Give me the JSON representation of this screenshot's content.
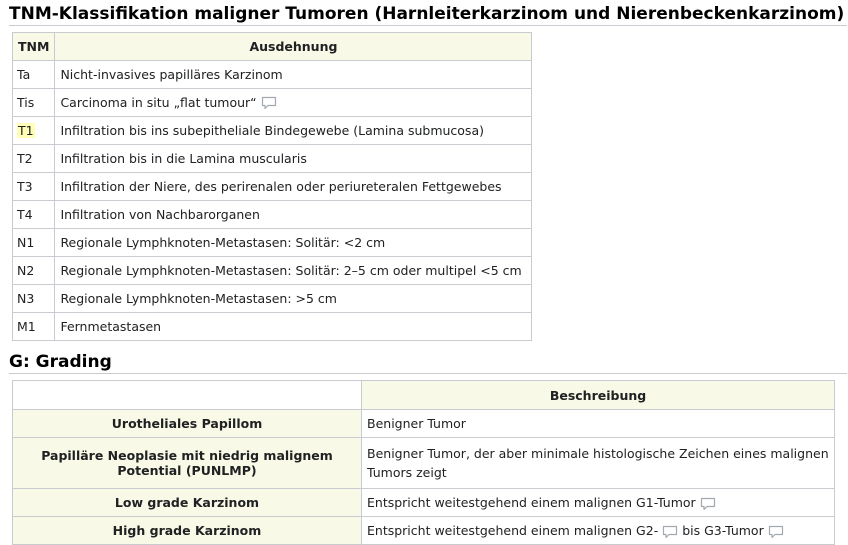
{
  "section1": {
    "title": "TNM-Klassifikation maligner Tumoren (Harnleiterkarzinom und Nierenbeckenkarzinom)",
    "columns": [
      "TNM",
      "Ausdehnung"
    ],
    "rows": [
      {
        "code": "Ta",
        "desc": "Nicht-invasives papilläres Karzinom"
      },
      {
        "code": "Tis",
        "desc": "Carcinoma in situ „flat tumour“"
      },
      {
        "code": "T1",
        "desc": "Infiltration bis ins subepitheliale Bindegewebe (Lamina submucosa)"
      },
      {
        "code": "T2",
        "desc": "Infiltration bis in die Lamina muscularis"
      },
      {
        "code": "T3",
        "desc": "Infiltration der Niere, des perirenalen oder periureteralen Fettgewebes"
      },
      {
        "code": "T4",
        "desc": "Infiltration von Nachbarorganen"
      },
      {
        "code": "N1",
        "desc": "Regionale Lymphknoten-Metastasen: Solitär: <2 cm"
      },
      {
        "code": "N2",
        "desc": "Regionale Lymphknoten-Metastasen: Solitär: 2–5 cm oder multipel <5 cm"
      },
      {
        "code": "N3",
        "desc": "Regionale Lymphknoten-Metastasen: >5 cm"
      },
      {
        "code": "M1",
        "desc": "Fernmetastasen"
      }
    ]
  },
  "section2": {
    "title": "G: Grading",
    "columns": [
      "",
      "Beschreibung"
    ],
    "rows": [
      {
        "name": "Urotheliales Papillom",
        "desc": "Benigner Tumor"
      },
      {
        "name": "Papilläre Neoplasie mit niedrig malignem Potential (PUNLMP)",
        "desc": "Benigner Tumor, der aber minimale histologische Zeichen eines malignen Tumors zeigt"
      },
      {
        "name": "Low grade Karzinom",
        "desc": "Entspricht weitestgehend einem malignen G1-Tumor"
      },
      {
        "name": "High grade Karzinom",
        "desc_a": "Entspricht weitestgehend einem malignen G2-",
        "desc_b": "bis G3-Tumor"
      }
    ]
  },
  "icons": {
    "comment": "speech-bubble-icon"
  },
  "colors": {
    "header_bg": "#f8f9e7",
    "highlight": "#ffffb8",
    "border": "#c8ccd1"
  }
}
